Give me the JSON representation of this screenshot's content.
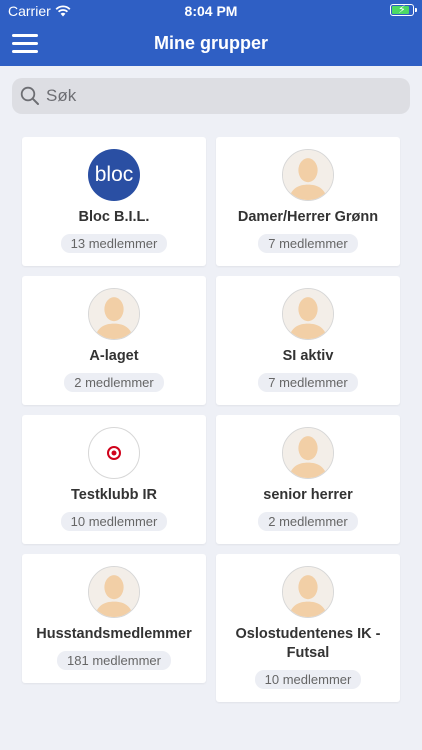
{
  "status_bar": {
    "carrier": "Carrier",
    "time": "8:04 PM",
    "battery_level": 0.9
  },
  "nav": {
    "title": "Mine grupper"
  },
  "search": {
    "placeholder": "Søk",
    "value": ""
  },
  "groups": [
    {
      "name": "Bloc B.I.L.",
      "members": "13 medlemmer",
      "avatar": "bloc-logo",
      "logo_text": "bloc"
    },
    {
      "name": "Damer/Herrer Grønn",
      "members": "7 medlemmer",
      "avatar": "person-icon"
    },
    {
      "name": "A-laget",
      "members": "2 medlemmer",
      "avatar": "person-icon"
    },
    {
      "name": "SI aktiv",
      "members": "7 medlemmer",
      "avatar": "person-icon"
    },
    {
      "name": "Testklubb IR",
      "members": "10 medlemmer",
      "avatar": "target-logo"
    },
    {
      "name": "senior herrer",
      "members": "2 medlemmer",
      "avatar": "person-icon"
    },
    {
      "name": "Husstandsmedlemmer",
      "members": "181 medlemmer",
      "avatar": "person-icon"
    },
    {
      "name": "Oslostudentenes IK - Futsal",
      "members": "10 medlemmer",
      "avatar": "person-icon"
    }
  ],
  "colors": {
    "header": "#2f5fc4",
    "background": "#eef0f6",
    "bloc_logo": "#2a4fa3",
    "target_red": "#d0021b"
  }
}
